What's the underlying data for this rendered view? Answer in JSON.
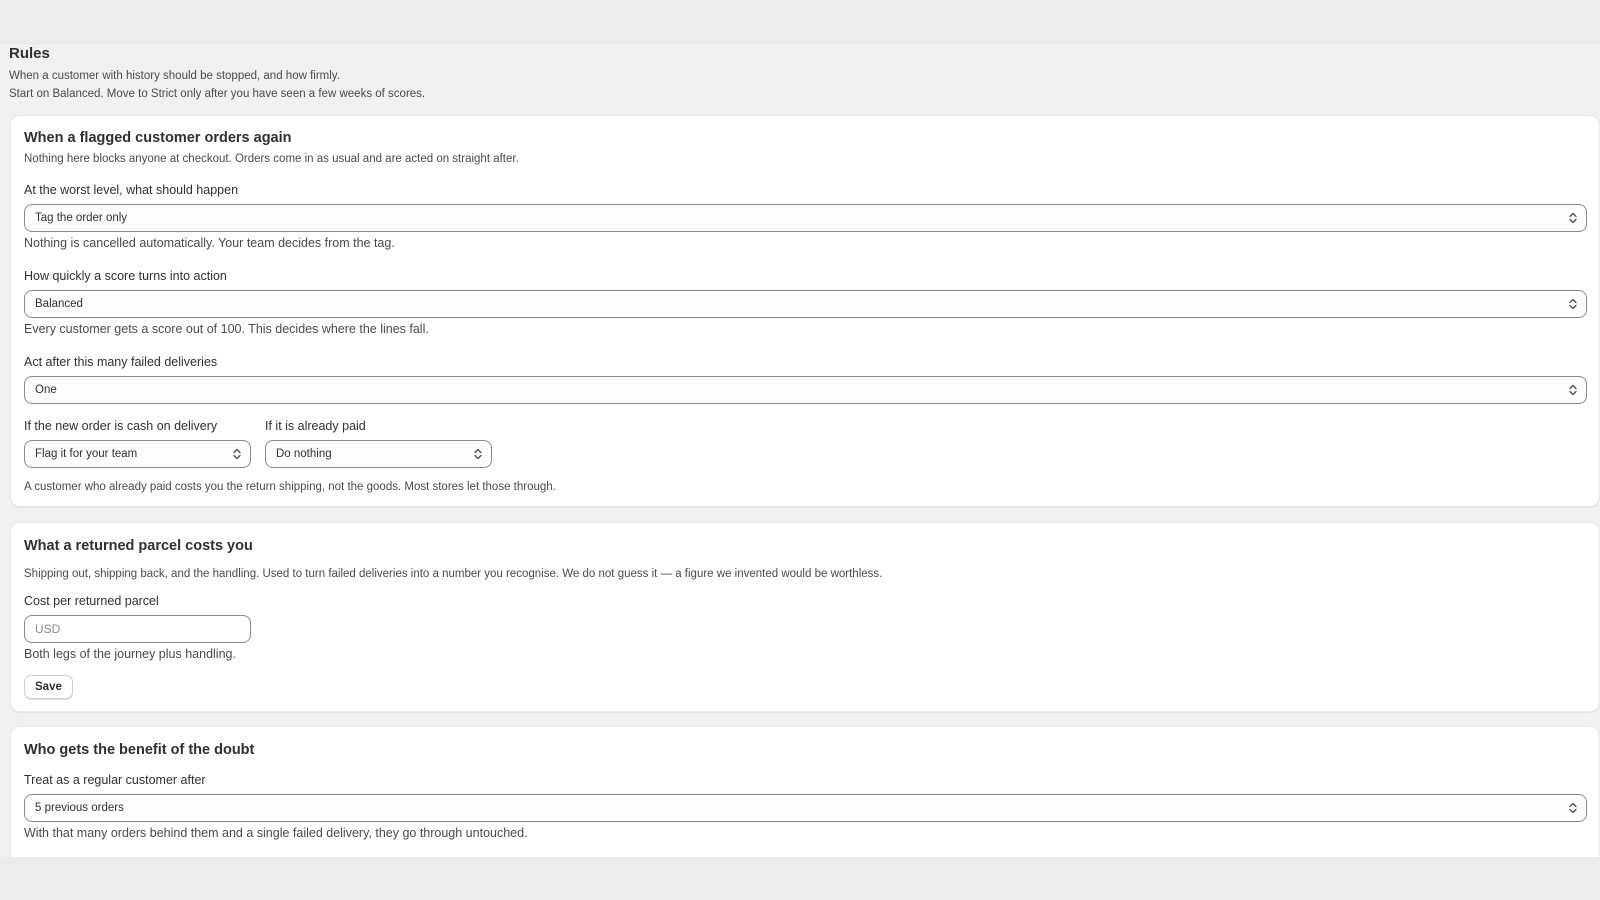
{
  "page": {
    "title": "Rules",
    "subtitle_1": "When a customer with history should be stopped, and how firmly.",
    "subtitle_2": "Start on Balanced. Move to Strict only after you have seen a few weeks of scores."
  },
  "flagged_card": {
    "title": "When a flagged customer orders again",
    "description": "Nothing here blocks anyone at checkout. Orders come in as usual and are acted on straight after.",
    "worst_level": {
      "label": "At the worst level, what should happen",
      "value": "Tag the order only",
      "help": "Nothing is cancelled automatically. Your team decides from the tag."
    },
    "speed": {
      "label": "How quickly a score turns into action",
      "value": "Balanced",
      "help": "Every customer gets a score out of 100. This decides where the lines fall."
    },
    "failed_deliveries": {
      "label": "Act after this many failed deliveries",
      "value": "One"
    },
    "cod": {
      "label": "If the new order is cash on delivery",
      "value": "Flag it for your team"
    },
    "paid": {
      "label": "If it is already paid",
      "value": "Do nothing"
    },
    "footnote": "A customer who already paid costs you the return shipping, not the goods. Most stores let those through."
  },
  "cost_card": {
    "title": "What a returned parcel costs you",
    "description": "Shipping out, shipping back, and the handling. Used to turn failed deliveries into a number you recognise. We do not guess it — a figure we invented would be worthless.",
    "field_label": "Cost per returned parcel",
    "placeholder": "USD",
    "help": "Both legs of the journey plus handling.",
    "save_label": "Save"
  },
  "doubt_card": {
    "title": "Who gets the benefit of the doubt",
    "field_label": "Treat as a regular customer after",
    "value": "5 previous orders",
    "help": "With that many orders behind them and a single failed delivery, they go through untouched."
  },
  "icons": {
    "select_chevron": "chevron-up-down-icon"
  }
}
